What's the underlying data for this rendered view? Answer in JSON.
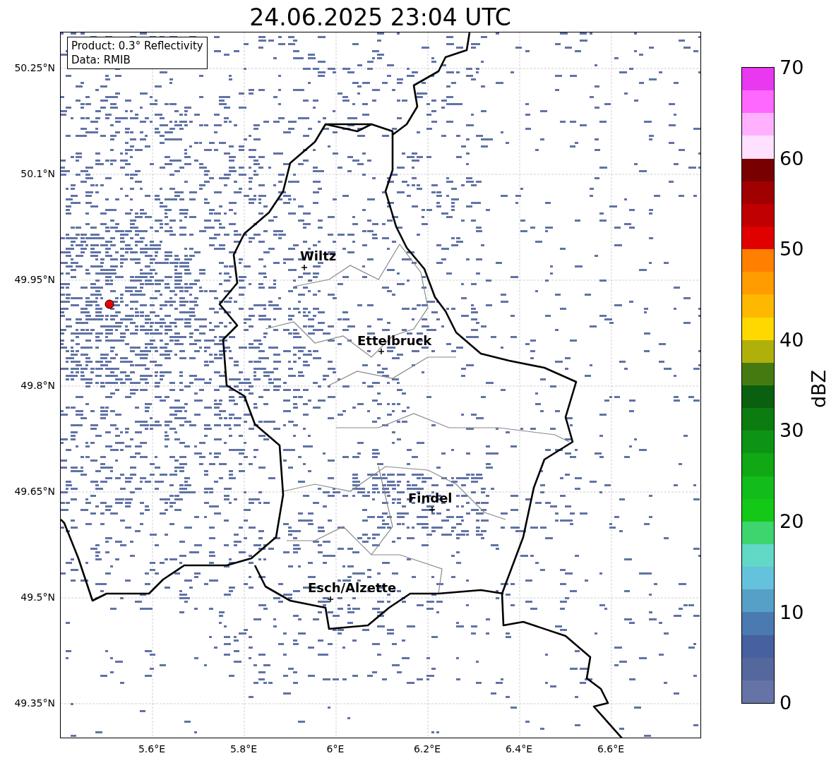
{
  "title": "24.06.2025 23:04 UTC",
  "info_box": [
    "Product: 0.3° Reflectivity",
    "Data: RMIB"
  ],
  "y_ticks": [
    "50.25°N",
    "50.1°N",
    "49.95°N",
    "49.8°N",
    "49.65°N",
    "49.5°N",
    "49.35°N"
  ],
  "x_ticks": [
    "5.6°E",
    "5.8°E",
    "6°E",
    "6.2°E",
    "6.4°E",
    "6.6°E"
  ],
  "cities": [
    {
      "name": "Wiltz"
    },
    {
      "name": "Ettelbruck"
    },
    {
      "name": "Findel"
    },
    {
      "name": "Esch/Alzette"
    }
  ],
  "colorbar": {
    "label": "dBZ",
    "ticks": [
      "70",
      "60",
      "50",
      "40",
      "30",
      "20",
      "10",
      "0"
    ],
    "bands": [
      {
        "color": "#6573a6"
      },
      {
        "color": "#55689e"
      },
      {
        "color": "#4660a0"
      },
      {
        "color": "#4a7ab0"
      },
      {
        "color": "#56a0c8"
      },
      {
        "color": "#64c2dc"
      },
      {
        "color": "#62d8c8"
      },
      {
        "color": "#3ed46e"
      },
      {
        "color": "#14c818"
      },
      {
        "color": "#12bc1a"
      },
      {
        "color": "#10a814"
      },
      {
        "color": "#0e9414"
      },
      {
        "color": "#0c7c10"
      },
      {
        "color": "#0a6010"
      },
      {
        "color": "#457a10"
      },
      {
        "color": "#b0b00a"
      },
      {
        "color": "#ffd800"
      },
      {
        "color": "#ffb800"
      },
      {
        "color": "#ff9c00"
      },
      {
        "color": "#ff8000"
      },
      {
        "color": "#e00000"
      },
      {
        "color": "#c00000"
      },
      {
        "color": "#a00000"
      },
      {
        "color": "#780000"
      },
      {
        "color": "#ffe0ff"
      },
      {
        "color": "#ffb0ff"
      },
      {
        "color": "#ff68ff"
      },
      {
        "color": "#e838f0"
      }
    ]
  }
}
